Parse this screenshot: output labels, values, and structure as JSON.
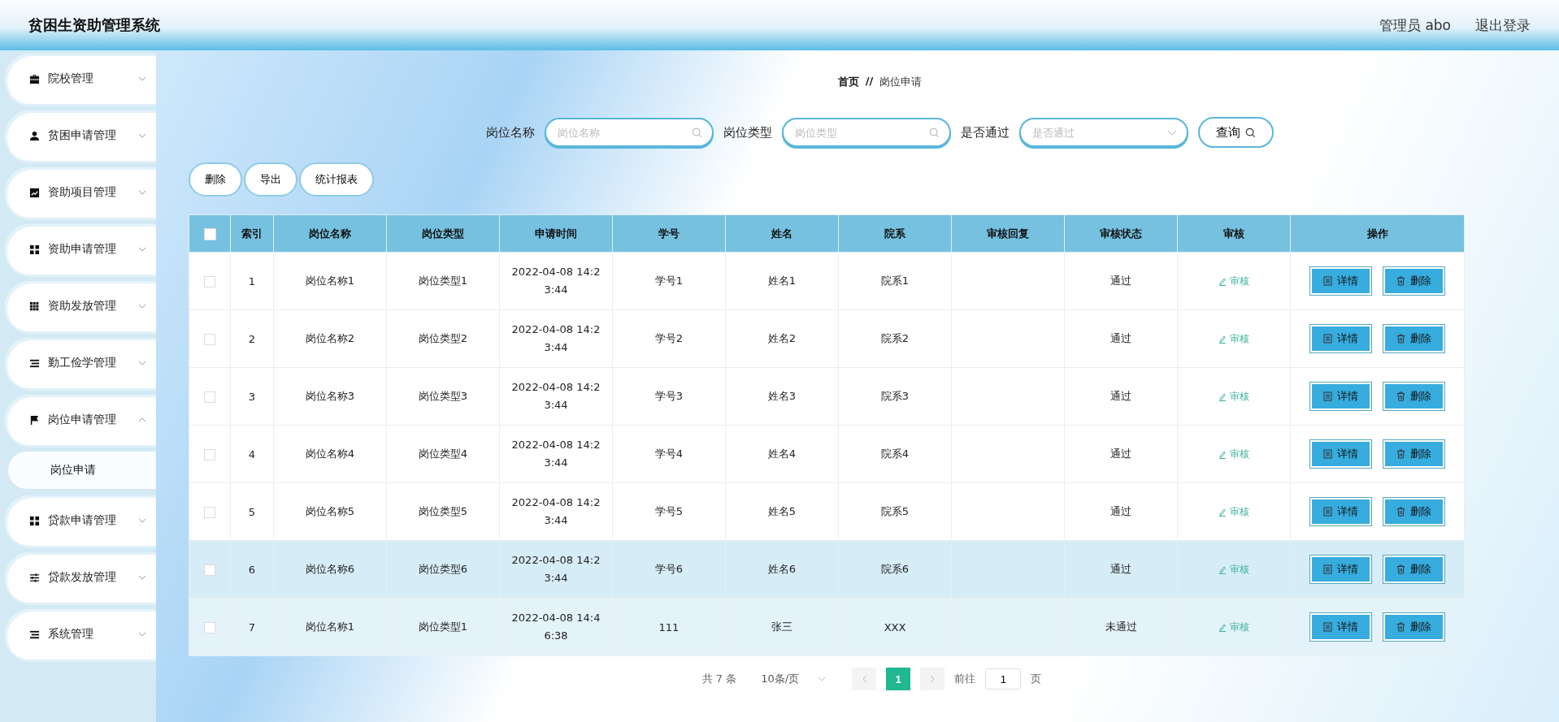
{
  "header": {
    "title": "贫困生资助管理系统",
    "user": "管理员 abo",
    "logout": "退出登录"
  },
  "sidebar": {
    "items": [
      {
        "label": "院校管理",
        "expanded": false
      },
      {
        "label": "贫困申请管理",
        "expanded": false
      },
      {
        "label": "资助项目管理",
        "expanded": false
      },
      {
        "label": "资助申请管理",
        "expanded": false
      },
      {
        "label": "资助发放管理",
        "expanded": false
      },
      {
        "label": "勤工俭学管理",
        "expanded": false
      },
      {
        "label": "岗位申请管理",
        "expanded": true,
        "children": [
          {
            "label": "岗位申请",
            "selected": true
          }
        ]
      },
      {
        "label": "贷款申请管理",
        "expanded": false
      },
      {
        "label": "贷款发放管理",
        "expanded": false
      },
      {
        "label": "系统管理",
        "expanded": false
      }
    ]
  },
  "breadcrumb": [
    "首页",
    "//",
    "岗位申请"
  ],
  "search": [
    {
      "kind": "text",
      "label": "岗位名称",
      "placeholder": "岗位名称"
    },
    {
      "kind": "text",
      "label": "岗位类型",
      "placeholder": "岗位类型"
    },
    {
      "kind": "select",
      "label": "是否通过",
      "placeholder": "是否通过"
    }
  ],
  "query_button": "查询",
  "actions": [
    "删除",
    "导出",
    "统计报表"
  ],
  "table": {
    "all_checked": false,
    "columns": [
      "索引",
      "岗位名称",
      "岗位类型",
      "申请时间",
      "学号",
      "姓名",
      "院系",
      "审核回复",
      "审核状态",
      "审核",
      "操作"
    ],
    "rows": [
      {
        "checked": false,
        "highlighted": false,
        "cells": [
          "1",
          "岗位名称1",
          "岗位类型1",
          "2022-04-08 14:23:44",
          "学号1",
          "姓名1",
          "院系1",
          "",
          "通过"
        ],
        "review": "审核",
        "detail": "详情",
        "delete": "删除"
      },
      {
        "checked": false,
        "highlighted": false,
        "cells": [
          "2",
          "岗位名称2",
          "岗位类型2",
          "2022-04-08 14:23:44",
          "学号2",
          "姓名2",
          "院系2",
          "",
          "通过"
        ],
        "review": "审核",
        "detail": "详情",
        "delete": "删除"
      },
      {
        "checked": false,
        "highlighted": false,
        "cells": [
          "3",
          "岗位名称3",
          "岗位类型3",
          "2022-04-08 14:23:44",
          "学号3",
          "姓名3",
          "院系3",
          "",
          "通过"
        ],
        "review": "审核",
        "detail": "详情",
        "delete": "删除"
      },
      {
        "checked": false,
        "highlighted": false,
        "cells": [
          "4",
          "岗位名称4",
          "岗位类型4",
          "2022-04-08 14:23:44",
          "学号4",
          "姓名4",
          "院系4",
          "",
          "通过"
        ],
        "review": "审核",
        "detail": "详情",
        "delete": "删除"
      },
      {
        "checked": false,
        "highlighted": false,
        "cells": [
          "5",
          "岗位名称5",
          "岗位类型5",
          "2022-04-08 14:23:44",
          "学号5",
          "姓名5",
          "院系5",
          "",
          "通过"
        ],
        "review": "审核",
        "detail": "详情",
        "delete": "删除"
      },
      {
        "checked": false,
        "highlighted": true,
        "cells": [
          "6",
          "岗位名称6",
          "岗位类型6",
          "2022-04-08 14:23:44",
          "学号6",
          "姓名6",
          "院系6",
          "",
          "通过"
        ],
        "review": "审核",
        "detail": "详情",
        "delete": "删除"
      },
      {
        "checked": false,
        "highlighted": true,
        "cells": [
          "7",
          "岗位名称1",
          "岗位类型1",
          "2022-04-08 14:46:38",
          "111",
          "张三",
          "XXX",
          "",
          "未通过"
        ],
        "review": "审核",
        "detail": "详情",
        "delete": "删除"
      }
    ]
  },
  "pagination": {
    "total": "共 7 条",
    "page_size": "10条/页",
    "pages": [
      {
        "label": "1",
        "selected": true
      }
    ],
    "goto_label": "前往",
    "goto_value": "1",
    "goto_suffix": "页"
  }
}
